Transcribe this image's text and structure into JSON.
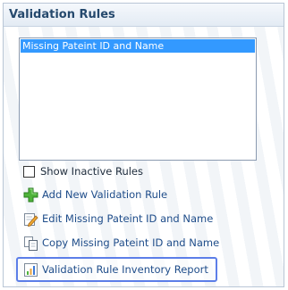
{
  "panel": {
    "title": "Validation Rules"
  },
  "rules_list": {
    "items": [
      "Missing Pateint ID and Name"
    ],
    "selected_index": 0
  },
  "show_inactive": {
    "label": "Show Inactive Rules",
    "checked": false
  },
  "actions": {
    "add_label": "Add New Validation Rule",
    "edit_label": "Edit Missing Pateint ID and Name",
    "copy_label": "Copy Missing Pateint ID and Name",
    "report_label": "Validation Rule Inventory Report"
  },
  "icons": {
    "add": "add-plus-icon",
    "edit": "edit-pencil-icon",
    "copy": "copy-document-icon",
    "report": "report-chart-icon"
  },
  "colors": {
    "title_text": "#25496d",
    "link_text": "#1f4d8a",
    "selection": "#3399ff",
    "highlight_border": "#5c7ee8"
  }
}
